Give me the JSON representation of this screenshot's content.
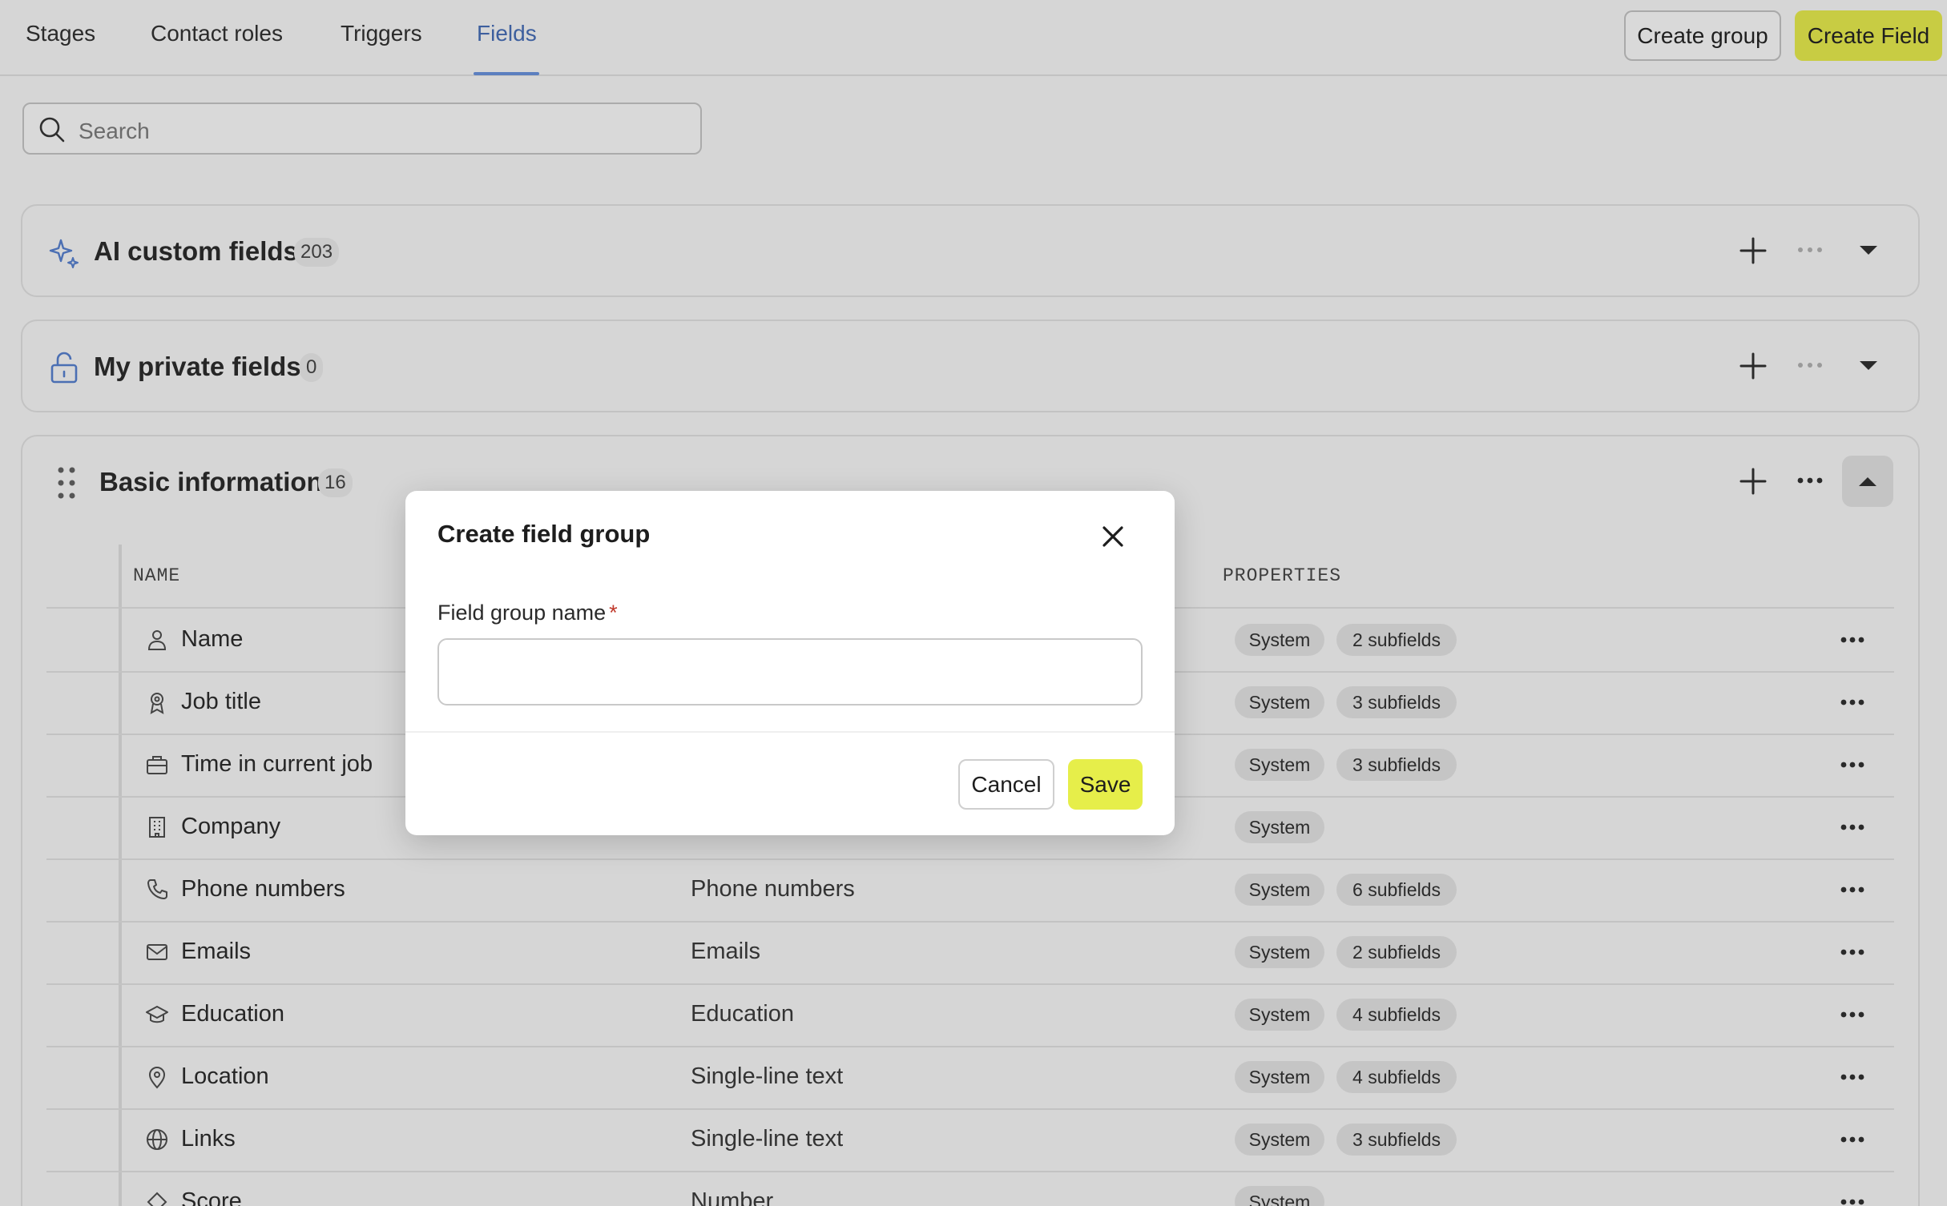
{
  "nav": {
    "tabs": [
      {
        "label": "Stages"
      },
      {
        "label": "Contact roles"
      },
      {
        "label": "Triggers"
      },
      {
        "label": "Fields",
        "active": true
      }
    ],
    "create_group_label": "Create group",
    "create_field_label": "Create Field"
  },
  "search": {
    "placeholder": "Search"
  },
  "groups": [
    {
      "title": "AI custom fields",
      "count": "203",
      "icon": "sparkle-icon"
    },
    {
      "title": "My private fields",
      "count": "0",
      "icon": "lock-icon"
    },
    {
      "title": "Basic information",
      "count": "16",
      "icon": "drag-handle-icon",
      "expanded": true
    }
  ],
  "table": {
    "columns": [
      "NAME",
      "PROPERTIES"
    ],
    "rows": [
      {
        "name": "Name",
        "icon": "person-icon",
        "type": "",
        "badges": [
          "System",
          "2 subfields"
        ]
      },
      {
        "name": "Job title",
        "icon": "badge-icon",
        "type": "",
        "badges": [
          "System",
          "3 subfields"
        ]
      },
      {
        "name": "Time in current job",
        "icon": "briefcase-icon",
        "type": "",
        "badges": [
          "System",
          "3 subfields"
        ]
      },
      {
        "name": "Company",
        "icon": "building-icon",
        "type": "",
        "badges": [
          "System"
        ]
      },
      {
        "name": "Phone numbers",
        "icon": "phone-icon",
        "type": "Phone numbers",
        "badges": [
          "System",
          "6 subfields"
        ]
      },
      {
        "name": "Emails",
        "icon": "mail-icon",
        "type": "Emails",
        "badges": [
          "System",
          "2 subfields"
        ]
      },
      {
        "name": "Education",
        "icon": "graduation-cap-icon",
        "type": "Education",
        "badges": [
          "System",
          "4 subfields"
        ]
      },
      {
        "name": "Location",
        "icon": "map-pin-icon",
        "type": "Single-line text",
        "badges": [
          "System",
          "4 subfields"
        ]
      },
      {
        "name": "Links",
        "icon": "globe-icon",
        "type": "Single-line text",
        "badges": [
          "System",
          "3 subfields"
        ]
      },
      {
        "name": "Score",
        "icon": "score-icon",
        "type": "Number",
        "badges": [
          "System"
        ]
      }
    ]
  },
  "modal": {
    "title": "Create field group",
    "field_label": "Field group name",
    "required_mark": "*",
    "input_value": "",
    "cancel_label": "Cancel",
    "save_label": "Save"
  },
  "colors": {
    "accent_blue": "#3d5f9e",
    "primary_yellow": "#c8cc43",
    "save_yellow": "#e6ee4a",
    "backdrop": "#d6d6d6"
  }
}
